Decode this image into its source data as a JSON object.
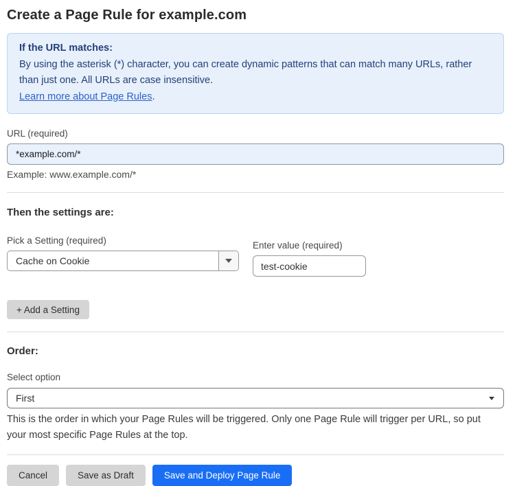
{
  "page": {
    "title": "Create a Page Rule for example.com"
  },
  "info_box": {
    "heading": "If the URL matches:",
    "body": "By using the asterisk (*) character, you can create dynamic patterns that can match many URLs, rather than just one. All URLs are case insensitive.",
    "link_text": "Learn more about Page Rules",
    "link_suffix": "."
  },
  "url_field": {
    "label": "URL (required)",
    "value": "*example.com/*",
    "example": "Example: www.example.com/*"
  },
  "settings_section": {
    "heading": "Then the settings are:",
    "setting_label": "Pick a Setting (required)",
    "setting_selected": "Cache on Cookie",
    "value_label": "Enter value (required)",
    "value": "test-cookie",
    "add_button_label": "+ Add a Setting"
  },
  "order_section": {
    "heading": "Order:",
    "select_label": "Select option",
    "selected_option": "First",
    "help_text": "This is the order in which your Page Rules will be triggered. Only one Page Rule will trigger per URL, so put your most specific Page Rules at the top."
  },
  "actions": {
    "cancel_label": "Cancel",
    "save_draft_label": "Save as Draft",
    "save_deploy_label": "Save and Deploy Page Rule"
  },
  "colors": {
    "accent_blue": "#1a6ef5",
    "info_box_bg": "#e7f0fb",
    "info_box_border": "#bad4f0",
    "info_text": "#24407a",
    "link_blue": "#2c62c8",
    "url_input_bg": "#e9f1fd",
    "gray_button_bg": "#d5d5d5"
  }
}
